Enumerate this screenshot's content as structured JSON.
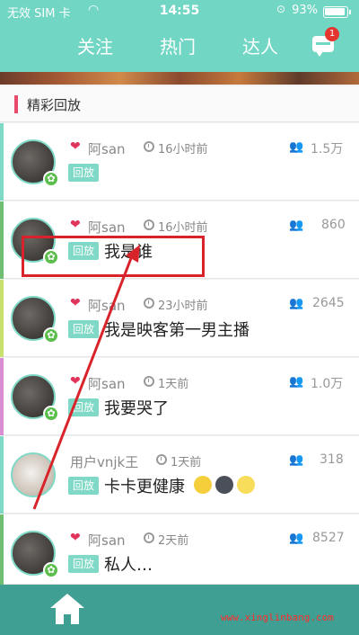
{
  "status_bar": {
    "carrier": "无效 SIM 卡",
    "time": "14:55",
    "battery": "93%"
  },
  "nav": {
    "tabs": [
      "关注",
      "热门",
      "达人"
    ],
    "message_badge": "1"
  },
  "section": {
    "title": "精彩回放"
  },
  "tag_label": "回放",
  "rows": [
    {
      "user": "阿san",
      "ago": "16小时前",
      "views": "1.5万",
      "title": ""
    },
    {
      "user": "阿san",
      "ago": "16小时前",
      "views": "860",
      "title": "我是谁"
    },
    {
      "user": "阿san",
      "ago": "23小时前",
      "views": "2645",
      "title": "我是映客第一男主播"
    },
    {
      "user": "阿san",
      "ago": "1天前",
      "views": "1.0万",
      "title": "我要哭了"
    },
    {
      "user": "用户vnjk王",
      "ago": "1天前",
      "views": "318",
      "title": "卡卡更健康"
    },
    {
      "user": "阿san",
      "ago": "2天前",
      "views": "8527",
      "title": "私人…"
    }
  ],
  "watermark": "www.xinglinbang.com",
  "colors": {
    "accent": "#71d6c3",
    "bottom": "#3e9f92",
    "annotation": "#d8232a"
  },
  "icons": [
    "wifi-icon",
    "lock-icon",
    "battery-icon",
    "message-icon",
    "lips-icon",
    "clock-icon",
    "people-icon",
    "star-badge-icon",
    "home-icon"
  ]
}
